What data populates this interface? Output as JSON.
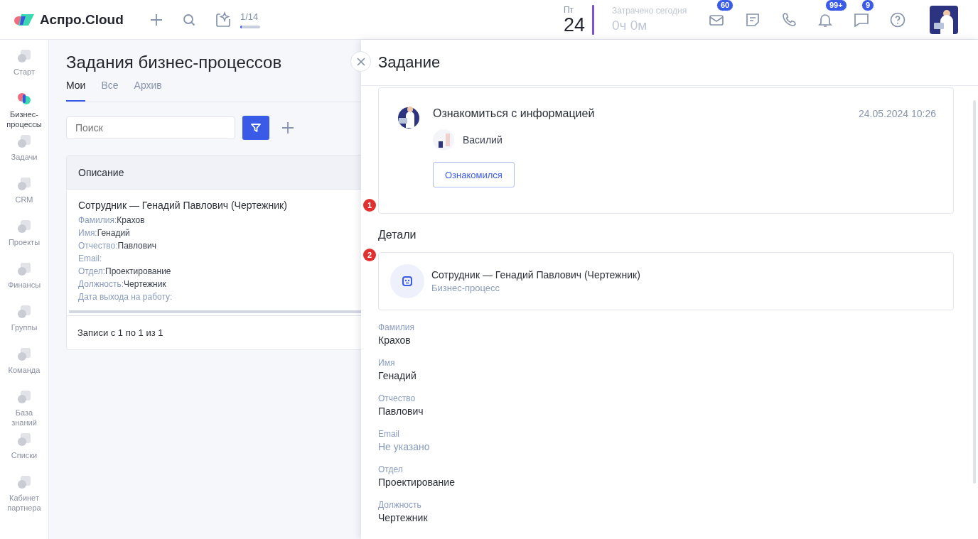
{
  "header": {
    "logo": "Аспро.Cloud",
    "tasks_counter": "1/14",
    "tasks_progress": {
      "level": 0.07
    },
    "day_name": "Пт",
    "day_number": "24",
    "spent_label": "Затрачено сегодня",
    "spent_value": "0ч 0м",
    "icons": [
      {
        "kind": "mail",
        "badge": "60"
      },
      {
        "kind": "note"
      },
      {
        "kind": "phone"
      },
      {
        "kind": "bell",
        "badge": "99+"
      },
      {
        "kind": "chat",
        "badge": "9"
      },
      {
        "kind": "help"
      }
    ]
  },
  "sidebar": {
    "items": [
      {
        "label": "Старт",
        "selected": false
      },
      {
        "label": "Бизнес-процессы",
        "selected": true
      },
      {
        "label": "Задачи",
        "selected": false
      },
      {
        "label": "CRM",
        "selected": false
      },
      {
        "label": "Проекты",
        "selected": false
      },
      {
        "label": "Финансы",
        "selected": false
      },
      {
        "label": "Группы",
        "selected": false
      },
      {
        "label": "Команда",
        "selected": false
      },
      {
        "label": "База знаний",
        "selected": false
      },
      {
        "label": "Списки",
        "selected": false
      },
      {
        "label": "Кабинет партнера",
        "selected": false
      }
    ]
  },
  "page": {
    "title": "Задания бизнес-процессов",
    "tabs": [
      {
        "label": "Мои",
        "selected": true
      },
      {
        "label": "Все",
        "selected": false
      },
      {
        "label": "Архив",
        "selected": false
      }
    ],
    "search": {
      "placeholder": "Поиск"
    },
    "table": {
      "columns": [
        "Описание"
      ],
      "rows": [
        {
          "title": "Сотрудник —  Генадий Павлович (Чертежник)",
          "fields": [
            {
              "label": "Фамилия:",
              "value": "Крахов"
            },
            {
              "label": "Имя:",
              "value": "Генадий"
            },
            {
              "label": "Отчество:",
              "value": "Павлович"
            },
            {
              "label": "Email:"
            },
            {
              "label": "Отдел:",
              "value": "Проектирование"
            },
            {
              "label": "Должность:",
              "value": "Чертежник"
            },
            {
              "label": "Дата выхода на работу:"
            }
          ]
        }
      ],
      "footer": "Записи с 1 по 1 из 1"
    }
  },
  "panel": {
    "title": "Задание",
    "task": {
      "title": "Ознакомиться с информацией",
      "date": "24.05.2024 10:26",
      "user": "Василий",
      "button": "Ознакомился"
    },
    "details_heading": "Детали",
    "process": {
      "title": "Сотрудник —  Генадий Павлович (Чертежник)",
      "subtitle": "Бизнес-процесс"
    },
    "fields": [
      {
        "label": "Фамилия",
        "value": "Крахов",
        "empty": false
      },
      {
        "label": "Имя",
        "value": "Генадий",
        "empty": false
      },
      {
        "label": "Отчество",
        "value": "Павлович",
        "empty": false
      },
      {
        "label": "Email",
        "value": "Не указано",
        "empty": true
      },
      {
        "label": "Отдел",
        "value": "Проектирование",
        "empty": false
      },
      {
        "label": "Должность",
        "value": "Чертежник",
        "empty": false
      }
    ]
  },
  "markers": [
    "1",
    "2"
  ]
}
